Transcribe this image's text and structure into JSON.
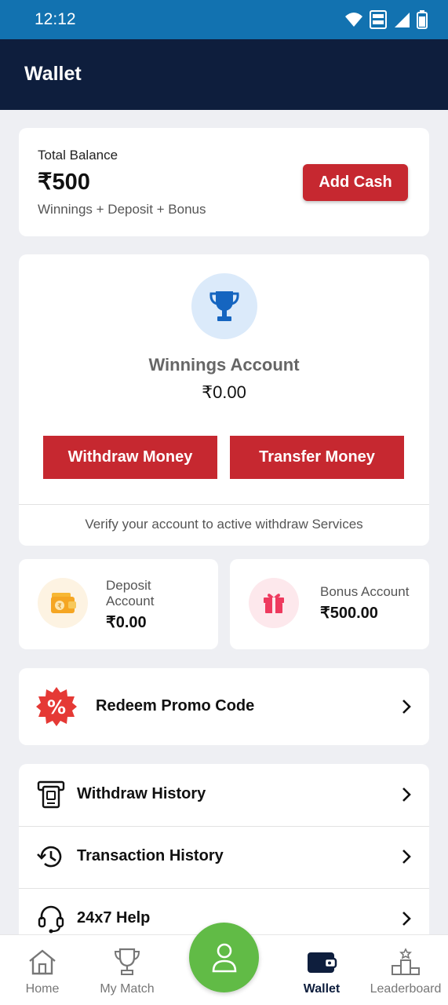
{
  "status_bar": {
    "time": "12:12"
  },
  "header": {
    "title": "Wallet"
  },
  "balance": {
    "label": "Total Balance",
    "amount": "₹500",
    "breakdown": "Winnings + Deposit + Bonus",
    "add_cash_label": "Add Cash"
  },
  "winnings": {
    "title": "Winnings Account",
    "amount": "₹0.00",
    "withdraw_label": "Withdraw Money",
    "transfer_label": "Transfer Money",
    "verify_text": "Verify your account to active withdraw Services"
  },
  "deposit": {
    "label": "Deposit Account",
    "amount": "₹0.00"
  },
  "bonus": {
    "label": "Bonus Account",
    "amount": "₹500.00"
  },
  "promo": {
    "label": "Redeem Promo Code"
  },
  "menu": {
    "items": [
      {
        "label": "Withdraw History",
        "icon": "receipt-icon"
      },
      {
        "label": "Transaction History",
        "icon": "history-icon"
      },
      {
        "label": "24x7 Help",
        "icon": "headset-icon"
      }
    ]
  },
  "bottom_nav": {
    "items": [
      {
        "label": "Home",
        "icon": "home-icon"
      },
      {
        "label": "My Match",
        "icon": "trophy-icon"
      },
      {
        "label": "Wallet",
        "icon": "wallet-icon",
        "active": true
      },
      {
        "label": "Leaderboard",
        "icon": "podium-icon"
      }
    ],
    "center_icon": "profile-icon"
  },
  "colors": {
    "status_bar": "#1272b0",
    "header": "#0e1e3d",
    "accent_red": "#c62830",
    "fab_green": "#61bb46",
    "background": "#eeeff3"
  }
}
